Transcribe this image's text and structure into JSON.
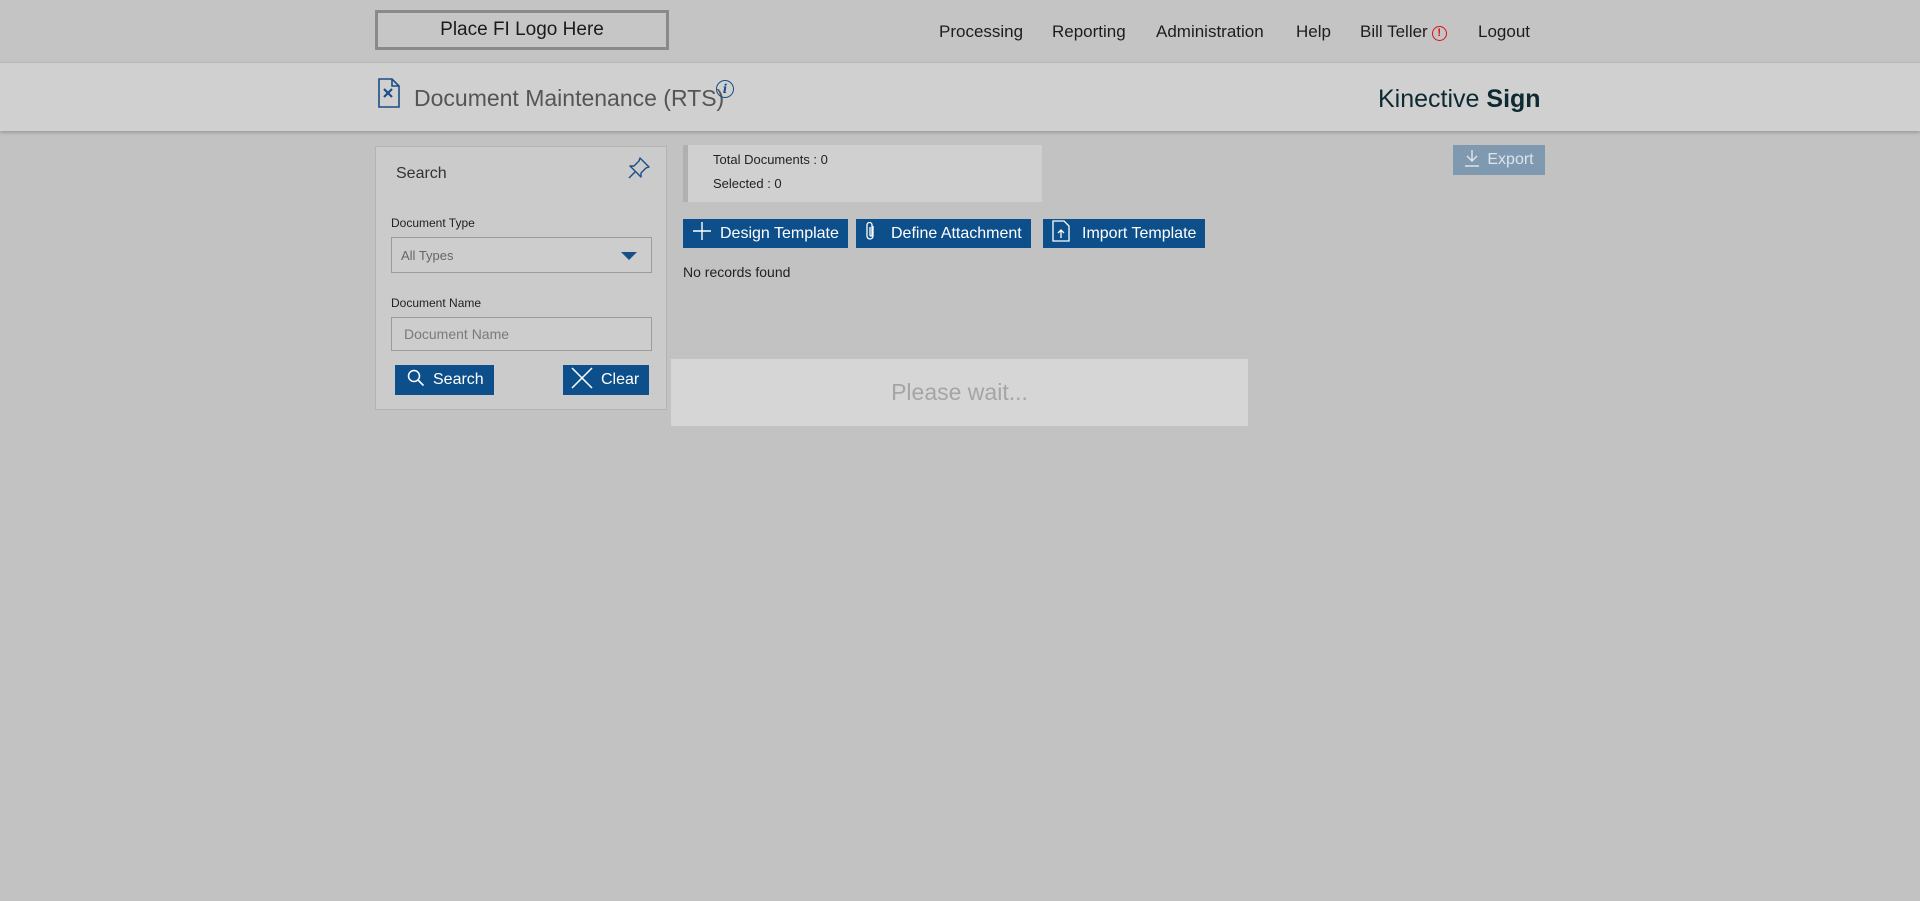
{
  "topbar": {
    "logo_text": "Place FI Logo Here",
    "nav": [
      {
        "label": "Processing"
      },
      {
        "label": "Reporting"
      },
      {
        "label": "Administration"
      },
      {
        "label": "Help"
      },
      {
        "label": "Bill Teller"
      },
      {
        "label": "Logout"
      }
    ],
    "user_alert_glyph": "!"
  },
  "header": {
    "page_title": "Document Maintenance (RTS)",
    "info_glyph": "i",
    "brand_light": "Kinective ",
    "brand_bold": "Sign"
  },
  "search_panel": {
    "title": "Search",
    "document_type_label": "Document Type",
    "document_type_value": "All Types",
    "document_name_label": "Document Name",
    "document_name_placeholder": "Document Name",
    "document_name_value": "",
    "search_button": "Search",
    "clear_button": "Clear"
  },
  "summary": {
    "total_documents": "Total Documents : 0",
    "selected": "Selected : 0"
  },
  "toolbar": {
    "design_template": "Design Template",
    "define_attachment": "Define Attachment",
    "import_template": "Import Template",
    "export": "Export"
  },
  "results": {
    "empty_message": "No records found"
  },
  "overlay": {
    "message": "Please wait..."
  },
  "colors": {
    "primary_button": "#0d4f8b",
    "disabled_button": "#7f99b1",
    "alert": "#dd1111",
    "background": "#c2c2c2"
  }
}
